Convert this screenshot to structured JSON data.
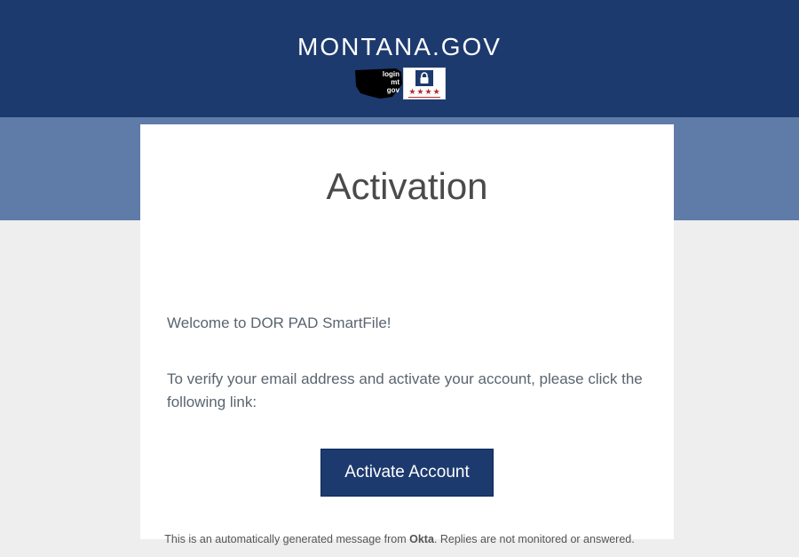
{
  "header": {
    "site_title": "MONTANA.GOV",
    "logo_text_line1": "login",
    "logo_text_line2": "mt",
    "logo_text_line3": "gov"
  },
  "card": {
    "title": "Activation",
    "welcome": "Welcome to DOR PAD SmartFile!",
    "instruction": "To verify your email address and activate your account, please click the following link:",
    "button_label": "Activate Account"
  },
  "footer": {
    "prefix": "This is an automatically generated message from ",
    "brand": "Okta",
    "suffix": ". Replies are not monitored or answered."
  }
}
